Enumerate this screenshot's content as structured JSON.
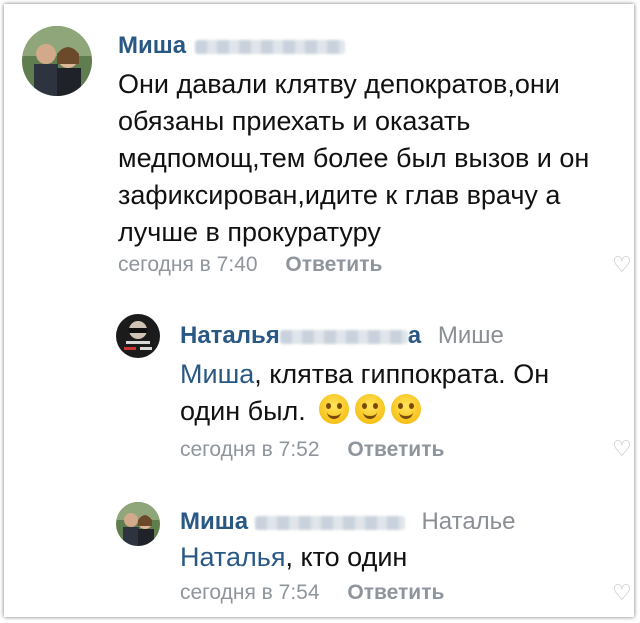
{
  "comments": [
    {
      "author": "Миша",
      "reply_to": "",
      "text": "Они давали клятву депократов,они обязаны приехать и оказать медпомощ,тем более был вызов и он зафиксирован,идите к глав врачу а лучше в прокуратуру",
      "time": "сегодня в 7:40",
      "reply_label": "Ответить"
    },
    {
      "author": "Наталья",
      "author_tail": "а",
      "reply_to": "Мише",
      "mention": "Миша",
      "text": ", клятва гиппократа. Он один был.",
      "time": "сегодня в 7:52",
      "reply_label": "Ответить"
    },
    {
      "author": "Миша",
      "reply_to": "Наталье",
      "mention": "Наталья",
      "text": ", кто один",
      "time": "сегодня в 7:54",
      "reply_label": "Ответить"
    }
  ],
  "icons": {
    "like": "heart-icon",
    "emoji": "smiling-face-emoji"
  }
}
